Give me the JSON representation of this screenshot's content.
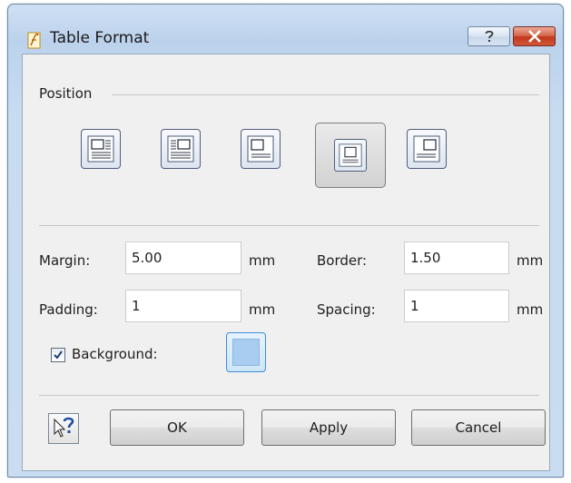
{
  "window": {
    "title": "Table Format",
    "accent": "#3f8ed8"
  },
  "icons": {
    "help": "question-icon",
    "close": "close-x-icon",
    "context_help": "whats-this-help-icon"
  },
  "position": {
    "label": "Position",
    "options": [
      "wrap-left",
      "wrap-center",
      "align-left",
      "align-center",
      "align-right"
    ],
    "selected_index": 3
  },
  "fields": {
    "margin": {
      "label": "Margin:",
      "value": "5.00",
      "unit": "mm"
    },
    "border": {
      "label": "Border:",
      "value": "1.50",
      "unit": "mm"
    },
    "padding": {
      "label": "Padding:",
      "value": "1",
      "unit": "mm"
    },
    "spacing": {
      "label": "Spacing:",
      "value": "1",
      "unit": "mm"
    }
  },
  "background": {
    "label": "Background:",
    "checked": true,
    "color": "#a9cdf0"
  },
  "buttons": {
    "ok": "OK",
    "apply": "Apply",
    "cancel": "Cancel"
  }
}
